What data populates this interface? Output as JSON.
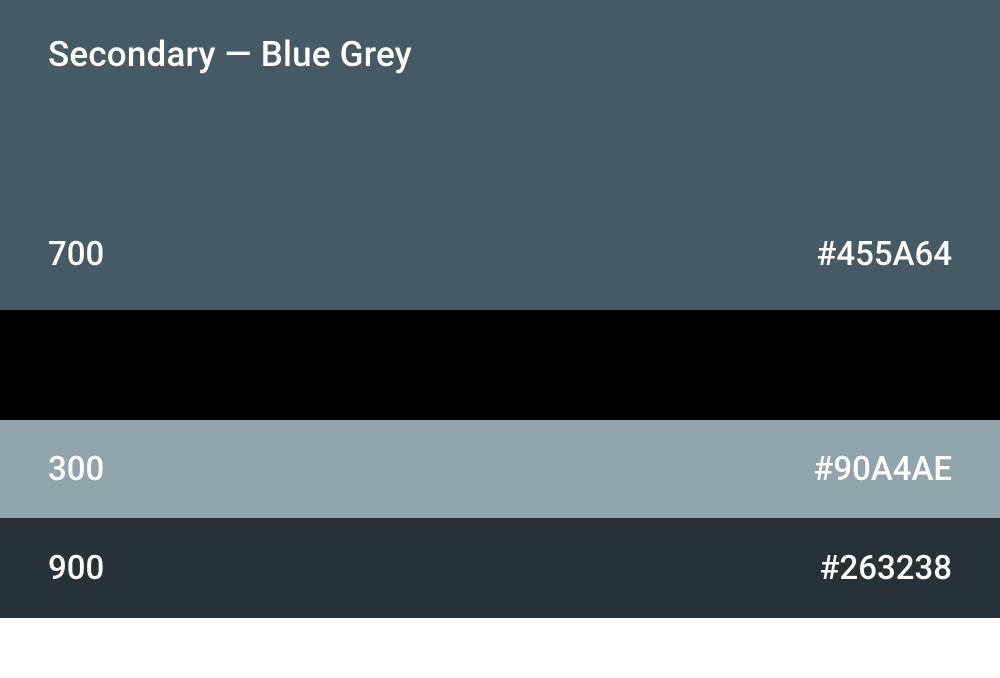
{
  "title": "Secondary — Blue Grey",
  "hero": {
    "shade": "700",
    "hex": "#455A64",
    "bg": "#455A64",
    "fg": "#FFFFFF"
  },
  "blank": {
    "bg": "#000000"
  },
  "swatches": [
    {
      "shade": "300",
      "hex": "#90A4AE",
      "bg": "#90A4AE",
      "fg": "#FFFFFF"
    },
    {
      "shade": "900",
      "hex": "#263238",
      "bg": "#263238",
      "fg": "#FFFFFF"
    }
  ]
}
